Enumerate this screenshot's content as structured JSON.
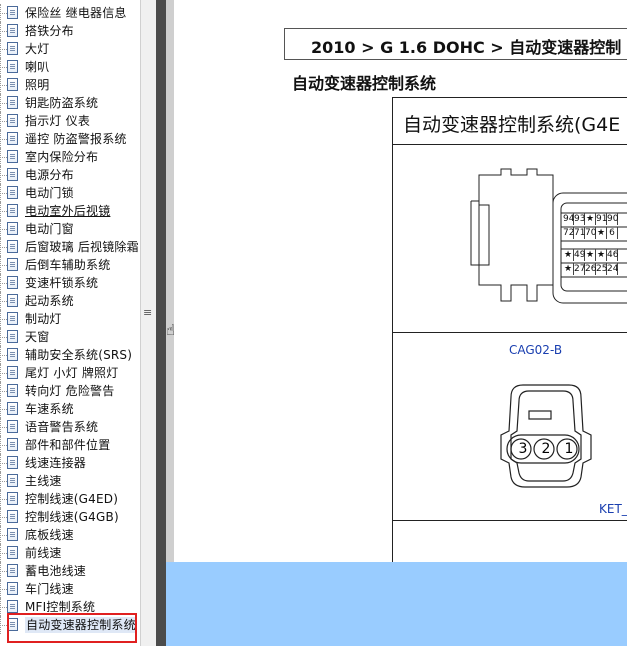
{
  "tree": {
    "items": [
      {
        "label": "保险丝 继电器信息",
        "underline": false
      },
      {
        "label": "搭铁分布",
        "underline": false
      },
      {
        "label": "大灯",
        "underline": false
      },
      {
        "label": "喇叭",
        "underline": false
      },
      {
        "label": "照明",
        "underline": false
      },
      {
        "label": "钥匙防盗系统",
        "underline": false
      },
      {
        "label": "指示灯 仪表",
        "underline": false
      },
      {
        "label": "遥控 防盗警报系统",
        "underline": false
      },
      {
        "label": "室内保险分布",
        "underline": false
      },
      {
        "label": "电源分布",
        "underline": false
      },
      {
        "label": "电动门锁",
        "underline": false
      },
      {
        "label": "电动室外后视镜",
        "underline": true
      },
      {
        "label": "电动门窗",
        "underline": false
      },
      {
        "label": "后窗玻璃 后视镜除霜",
        "underline": false
      },
      {
        "label": "后倒车辅助系统",
        "underline": false
      },
      {
        "label": "变速杆锁系统",
        "underline": false
      },
      {
        "label": "起动系统",
        "underline": false
      },
      {
        "label": "制动灯",
        "underline": false
      },
      {
        "label": "天窗",
        "underline": false
      },
      {
        "label": "辅助安全系统(SRS)",
        "underline": false
      },
      {
        "label": "尾灯 小灯 牌照灯",
        "underline": false
      },
      {
        "label": "转向灯 危险警告",
        "underline": false
      },
      {
        "label": "车速系统",
        "underline": false
      },
      {
        "label": "语音警告系统",
        "underline": false
      },
      {
        "label": "部件和部件位置",
        "underline": false
      },
      {
        "label": "线速连接器",
        "underline": false
      },
      {
        "label": "主线速",
        "underline": false
      },
      {
        "label": "控制线速(G4ED)",
        "underline": false
      },
      {
        "label": "控制线速(G4GB)",
        "underline": false
      },
      {
        "label": "底板线速",
        "underline": false
      },
      {
        "label": "前线速",
        "underline": false
      },
      {
        "label": "蓄电池线速",
        "underline": false
      },
      {
        "label": "车门线速",
        "underline": false
      },
      {
        "label": "MFI控制系统",
        "underline": false
      },
      {
        "label": "自动变速器控制系统",
        "underline": false,
        "selected": true
      }
    ]
  },
  "document": {
    "breadcrumb": "2010 > G 1.6 DOHC > 自动变速器控制",
    "section_title": "自动变速器控制系统",
    "diagram_title": "自动变速器控制系统(G4E",
    "connector_label": "CAG02-B",
    "ket_label": "KET_",
    "pins_row1": [
      "94",
      "93",
      "★",
      "91",
      "90"
    ],
    "pins_row2": [
      "72",
      "71",
      "70",
      "★",
      "6"
    ],
    "pins_row3": [
      "★",
      "49",
      "★",
      "★",
      "46"
    ],
    "pins_row4": [
      "★",
      "27",
      "26",
      "25",
      "24"
    ],
    "plug_pins": [
      "3",
      "2",
      "1"
    ]
  },
  "colors": {
    "selection_frame": "#e02020",
    "blue_area": "#99ccff",
    "label_blue": "#1a3fb0"
  }
}
